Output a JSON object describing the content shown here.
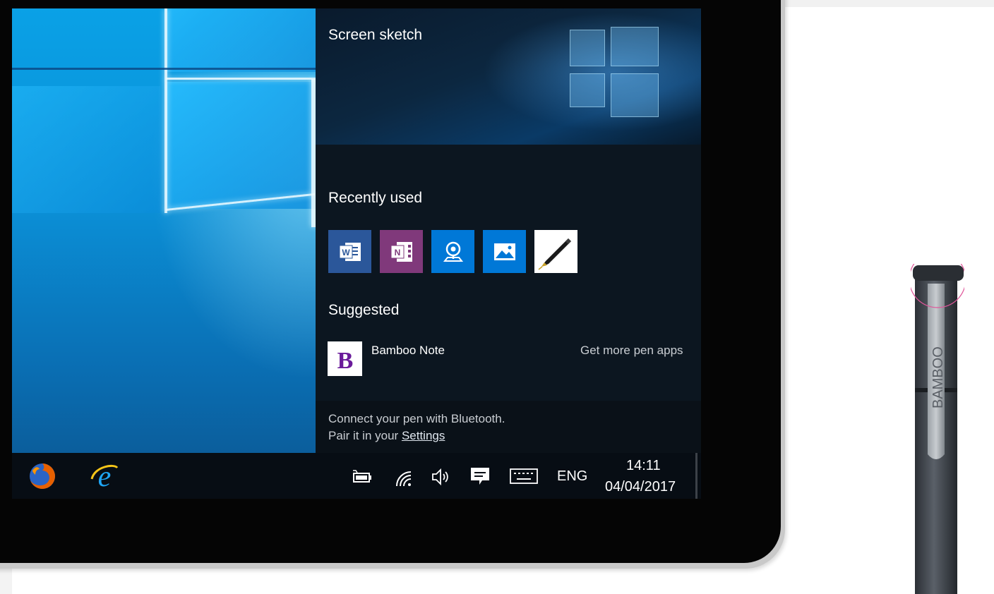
{
  "pen_workspace": {
    "screen_sketch_label": "Screen sketch",
    "recently_used_heading": "Recently used",
    "recent_apps": [
      {
        "name": "Word",
        "icon": "word-icon",
        "color": "#2b579a"
      },
      {
        "name": "OneNote",
        "icon": "onenote-icon",
        "color": "#80397b"
      },
      {
        "name": "Maps",
        "icon": "maps-icon",
        "color": "#0078d7"
      },
      {
        "name": "Photos",
        "icon": "photos-icon",
        "color": "#0078d7"
      },
      {
        "name": "Pen app",
        "icon": "fountain-pen-icon",
        "color": "#ffffff"
      }
    ],
    "suggested_heading": "Suggested",
    "suggested_app": {
      "name": "Bamboo Note",
      "icon": "bamboo-note-icon",
      "icon_letter": "B",
      "color": "#6a1b9a"
    },
    "get_more_link": "Get more pen apps",
    "bluetooth_line1": "Connect your pen with Bluetooth.",
    "bluetooth_line2_prefix": "Pair it in your ",
    "settings_link": "Settings"
  },
  "taskbar": {
    "pinned": [
      {
        "name": "Firefox",
        "icon": "firefox-icon"
      },
      {
        "name": "Internet Explorer",
        "icon": "internet-explorer-icon"
      }
    ],
    "tray_icons": [
      "battery-icon",
      "wifi-icon",
      "volume-icon",
      "action-center-icon",
      "keyboard-icon"
    ],
    "language": "ENG",
    "time": "14:11",
    "date": "04/04/2017"
  },
  "pen": {
    "brand_text": "BAMBOO",
    "highlight_color": "#e0569a"
  }
}
